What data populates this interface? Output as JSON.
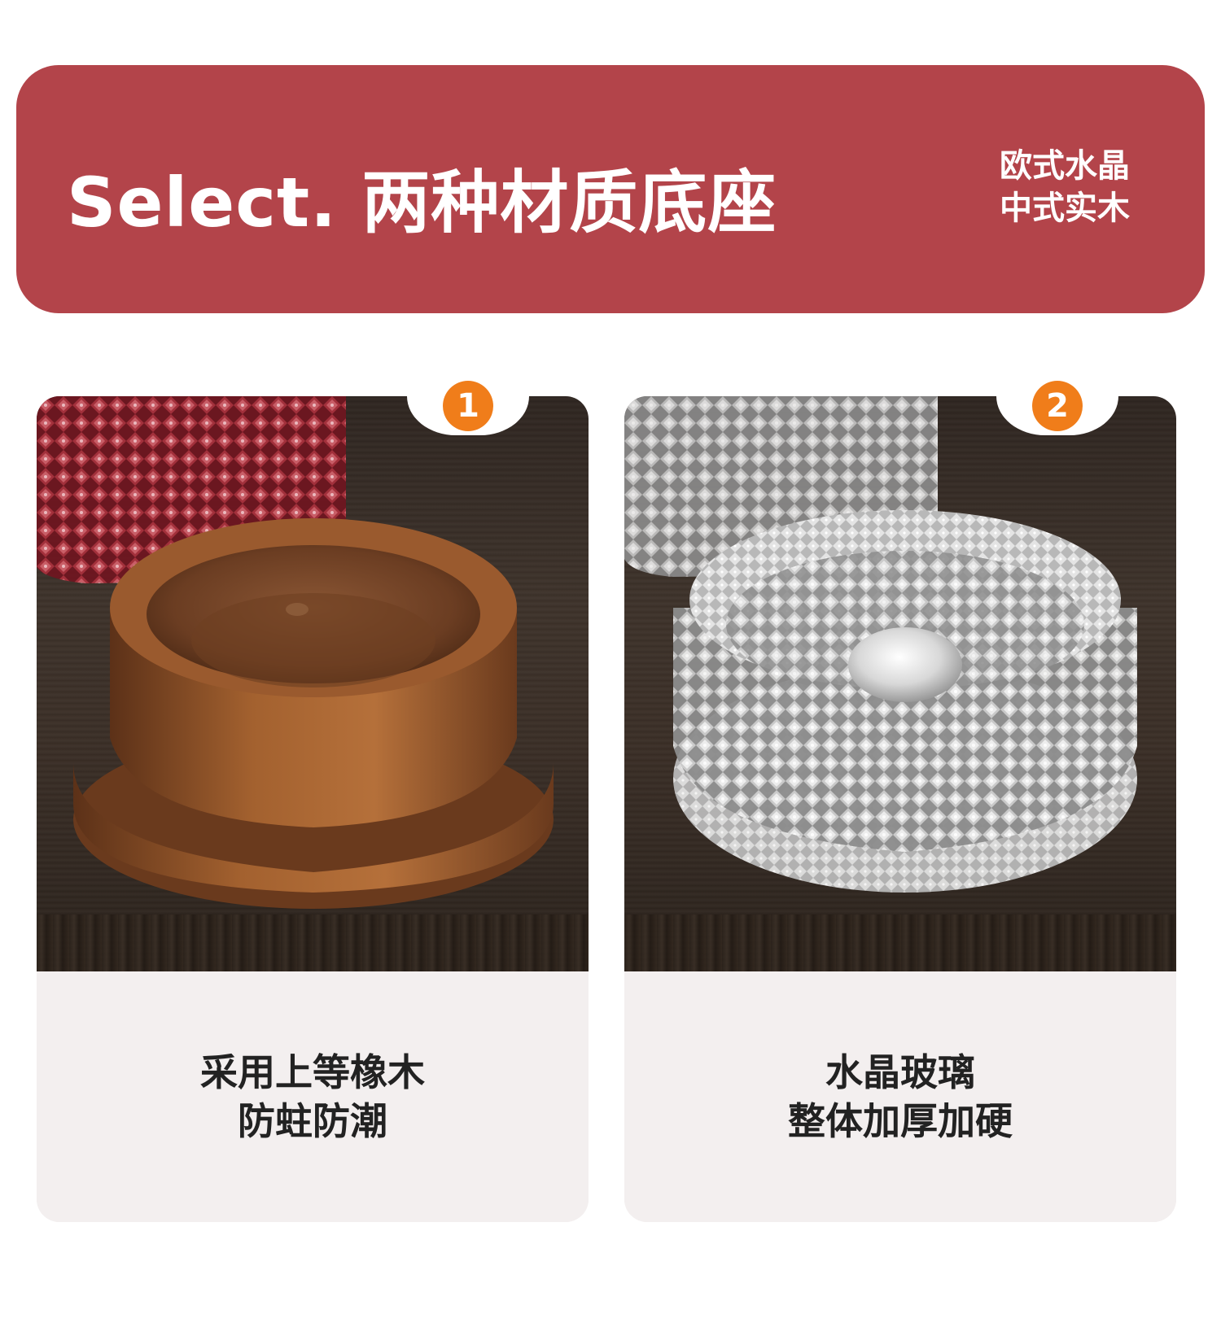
{
  "header": {
    "title": "Select. 两种材质底座",
    "subtitle_line1": "欧式水晶",
    "subtitle_line2": "中式实木"
  },
  "cards": [
    {
      "number": "1",
      "line1": "采用上等橡木",
      "line2": "防蛀防潮",
      "image_subject": "walnut-wood-decanter-base"
    },
    {
      "number": "2",
      "line1": "水晶玻璃",
      "line2": "整体加厚加硬",
      "image_subject": "crystal-glass-decanter-base"
    }
  ],
  "colors": {
    "banner": "#b3444a",
    "badge": "#f07d1a",
    "caption_bg": "#f3efef",
    "text_dark": "#222222"
  }
}
